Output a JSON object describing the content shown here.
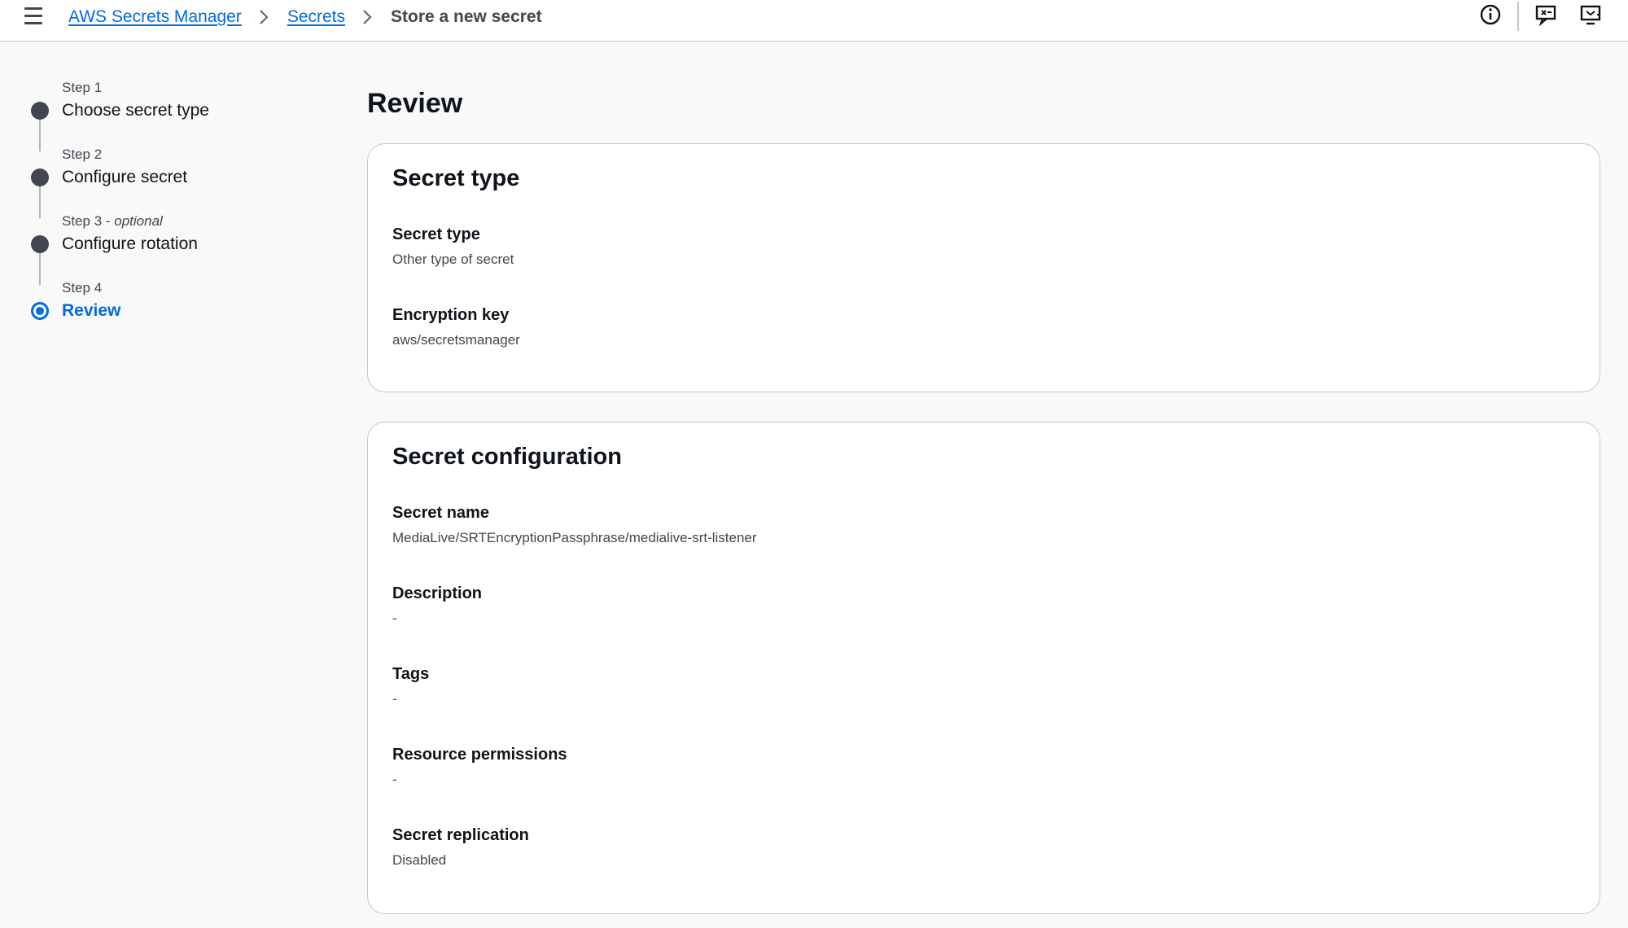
{
  "breadcrumb": {
    "items": [
      "AWS Secrets Manager",
      "Secrets"
    ],
    "current": "Store a new secret"
  },
  "icons": {
    "menu": "hamburger-menu-icon",
    "info": "info-icon",
    "notifications": "chat-notification-icon",
    "split_panel": "split-panel-icon",
    "separator": "chevron-right-icon"
  },
  "steps": [
    {
      "label": "Step 1",
      "title": "Choose secret type",
      "state": "complete"
    },
    {
      "label": "Step 2",
      "title": "Configure secret",
      "state": "complete"
    },
    {
      "label": "Step 3",
      "label_suffix": "optional",
      "title": "Configure rotation",
      "state": "complete"
    },
    {
      "label": "Step 4",
      "title": "Review",
      "state": "active"
    }
  ],
  "page_title": "Review",
  "secret_type_card": {
    "title": "Secret type",
    "fields": [
      {
        "label": "Secret type",
        "value": "Other type of secret"
      },
      {
        "label": "Encryption key",
        "value": "aws/secretsmanager"
      }
    ]
  },
  "secret_config_card": {
    "title": "Secret configuration",
    "fields": [
      {
        "label": "Secret name",
        "value": "MediaLive/SRTEncryptionPassphrase/medialive-srt-listener"
      },
      {
        "label": "Description",
        "value": "-"
      },
      {
        "label": "Tags",
        "value": "-"
      },
      {
        "label": "Resource permissions",
        "value": "-"
      },
      {
        "label": "Secret replication",
        "value": "Disabled"
      }
    ]
  },
  "colors": {
    "link": "#006ce0",
    "text": "#0f141a",
    "muted": "#424650",
    "border": "#c6c6cd",
    "background": "#f9f9f9"
  }
}
